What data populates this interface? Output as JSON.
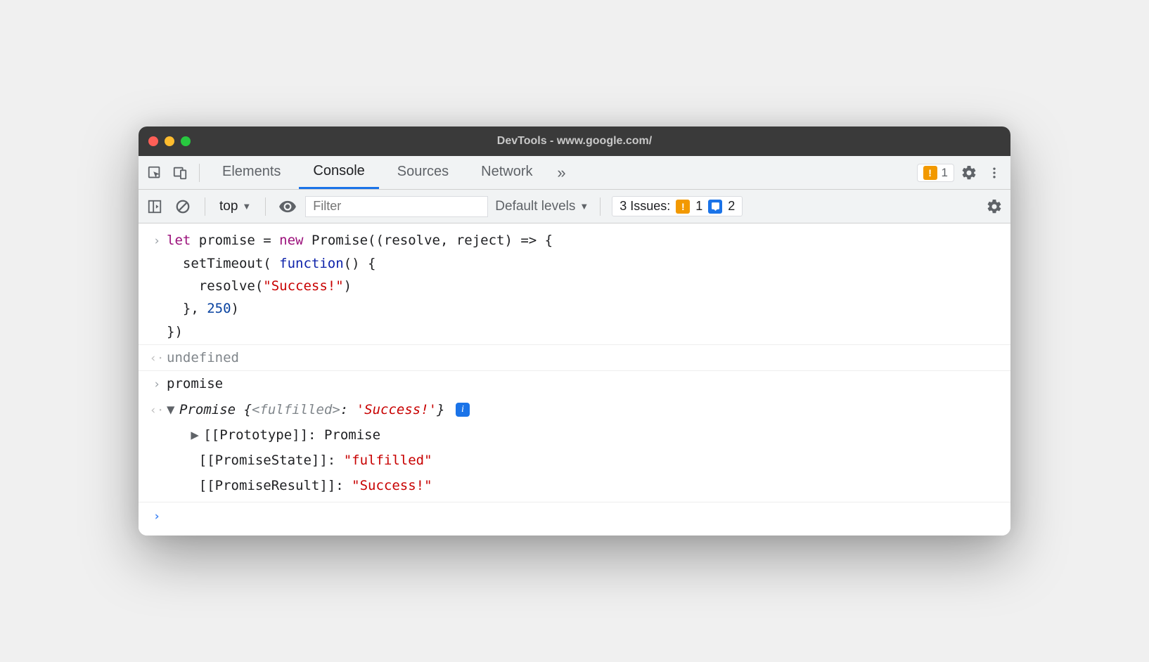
{
  "window": {
    "title": "DevTools - www.google.com/"
  },
  "tabs": {
    "elements": "Elements",
    "console": "Console",
    "sources": "Sources",
    "network": "Network"
  },
  "warning_count": "1",
  "subbar": {
    "context": "top",
    "filter_placeholder": "Filter",
    "levels": "Default levels",
    "issues_label": "3 Issues:",
    "issues_warn_count": "1",
    "issues_info_count": "2"
  },
  "code": {
    "l1_let": "let",
    "l1_a": " promise = ",
    "l1_new": "new",
    "l1_b": " Promise((resolve, reject) => {",
    "l2_a": "  setTimeout( ",
    "l2_fn": "function",
    "l2_b": "() {",
    "l3_a": "    resolve(",
    "l3_str": "\"Success!\"",
    "l3_b": ")",
    "l4_a": "  }, ",
    "l4_num": "250",
    "l4_b": ")",
    "l5": "})",
    "undefined": "undefined",
    "input2": "promise",
    "result_prefix": "Promise {",
    "result_state": "<fulfilled>",
    "result_colon": ": ",
    "result_val": "'Success!'",
    "result_suffix": "}",
    "proto_label": "[[Prototype]]",
    "proto_val": "Promise",
    "pstate_label": "[[PromiseState]]",
    "pstate_val": "\"fulfilled\"",
    "presult_label": "[[PromiseResult]]",
    "presult_val": "\"Success!\""
  }
}
